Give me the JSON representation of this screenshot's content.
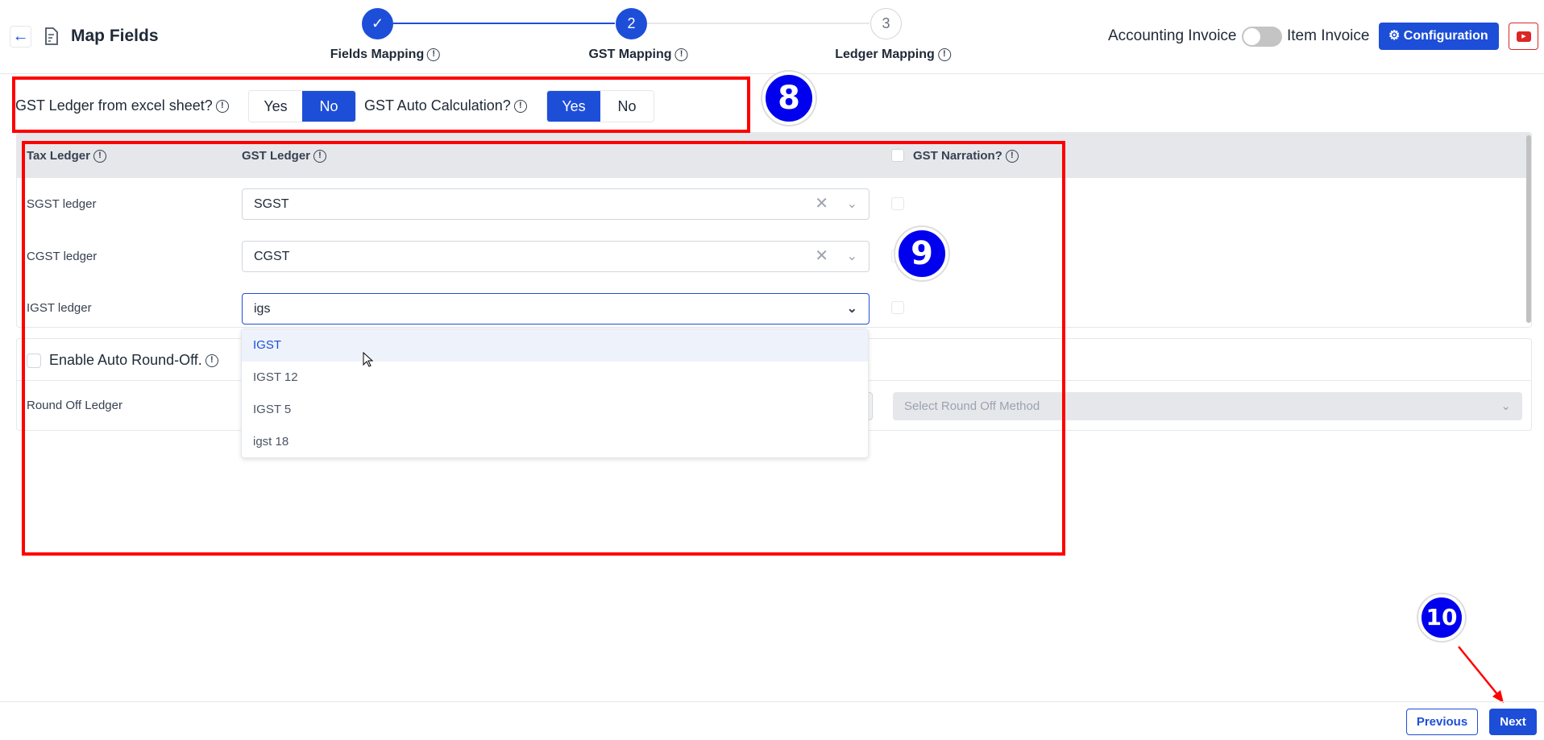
{
  "header": {
    "title": "Map Fields",
    "back_icon": "arrow-left-icon",
    "doc_icon": "document-edit-icon",
    "steps": [
      {
        "number": "",
        "label": "Fields Mapping",
        "state": "done"
      },
      {
        "number": "2",
        "label": "GST Mapping",
        "state": "current"
      },
      {
        "number": "3",
        "label": "Ledger Mapping",
        "state": "todo"
      }
    ],
    "toggle_left": "Accounting Invoice",
    "toggle_right": "Item Invoice",
    "toggle_on": false,
    "config_label": "Configuration",
    "accent": "#1d4ed8"
  },
  "options": {
    "gst_ledger_excel_label": "GST Ledger from excel sheet?",
    "gst_ledger_excel_yes": "Yes",
    "gst_ledger_excel_no": "No",
    "gst_ledger_excel_value": "No",
    "gst_auto_calc_label": "GST Auto Calculation?",
    "gst_auto_calc_yes": "Yes",
    "gst_auto_calc_no": "No",
    "gst_auto_calc_value": "Yes"
  },
  "table": {
    "headers": {
      "tax_ledger": "Tax Ledger",
      "gst_ledger": "GST Ledger",
      "gst_narration": "GST Narration?"
    },
    "rows": [
      {
        "label": "SGST ledger",
        "value": "SGST"
      },
      {
        "label": "CGST ledger",
        "value": "CGST"
      },
      {
        "label": "IGST ledger",
        "value": "igs"
      }
    ]
  },
  "dropdown": {
    "options": [
      "IGST",
      "IGST 12",
      "IGST 5",
      "igst 18"
    ],
    "highlighted": "IGST"
  },
  "roundoff": {
    "enable_label": "Enable Auto Round-Off.",
    "ledger_label": "Round Off Ledger",
    "method_placeholder": "Select Round Off Method"
  },
  "footer": {
    "previous": "Previous",
    "next": "Next"
  },
  "annotations": {
    "b8": "8",
    "b9": "9",
    "b10": "10",
    "color": "#ff0000"
  }
}
